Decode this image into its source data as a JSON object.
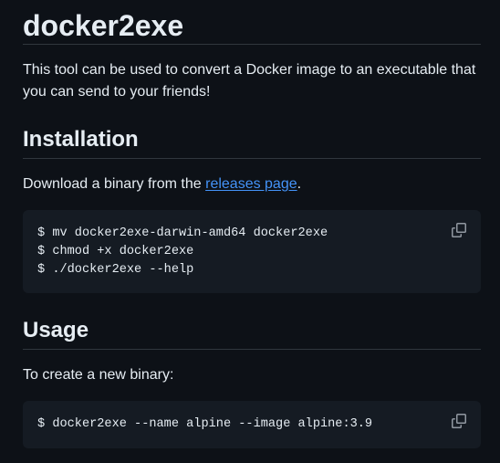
{
  "title": "docker2exe",
  "intro": "This tool can be used to convert a Docker image to an executable that you can send to your friends!",
  "installation": {
    "heading": "Installation",
    "text_before": "Download a binary from the ",
    "link_label": "releases page",
    "text_after": ".",
    "code_lines": [
      "$ mv docker2exe-darwin-amd64 docker2exe",
      "$ chmod +x docker2exe",
      "$ ./docker2exe --help"
    ]
  },
  "usage": {
    "heading": "Usage",
    "text": "To create a new binary:",
    "code_lines": [
      "$ docker2exe --name alpine --image alpine:3.9"
    ]
  },
  "icons": {
    "copy": "copy-icon"
  },
  "colors": {
    "background": "#0d1117",
    "code_background": "#151b23",
    "text": "#e6edf3",
    "link": "#4493f8",
    "divider": "#30363d"
  }
}
